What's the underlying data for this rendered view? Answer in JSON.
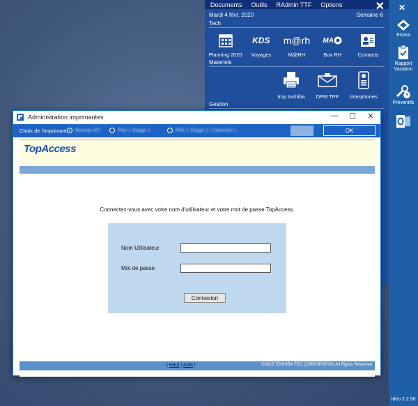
{
  "launcher": {
    "menu": [
      "Documents",
      "Outils",
      "RAdmin TTF",
      "Options"
    ],
    "close": "✕",
    "date": "Mardi 4 févr. 2020",
    "week": "Semaine 6",
    "sections": {
      "tech": "Tech",
      "materiels": "Materiels",
      "gestion": "Gestion"
    },
    "tech_tiles": [
      "Planning 2020",
      "Voyages",
      "M@RH",
      "Box RH",
      "Contacts"
    ],
    "tech_logos": {
      "kds": "KDS",
      "marh": "m@rh",
      "ma": "MA"
    },
    "materiel_tiles": [
      "Imp toshiba",
      "DPM TPF",
      "Interphones"
    ]
  },
  "sidebar": {
    "close": "✕",
    "items": [
      "Enova",
      "Rapport Vacation",
      "Préventifs"
    ],
    "version": "Ideo 2.2.56",
    "colors": {
      "bg": "#1f5fa8"
    }
  },
  "dialog": {
    "title": "Administration imprimantes",
    "min": "—",
    "max": "☐",
    "close": "✕",
    "printer_label": "Choix de l'imprimante :",
    "printers": [
      "Bureau RT",
      "Plot 1 Etage 1",
      "Plot 1 Etage 2 ( Direction )"
    ],
    "ok": "OK"
  },
  "topaccess": {
    "logo": "TopAccess",
    "message": "Connectez-vous avec votre nom d'utilisateur et votre mot de passe TopAccess.",
    "username_label": "Nom Utilisateur",
    "password_label": "Mot de passe",
    "username_value": "",
    "password_value": "",
    "connect": "Connexion",
    "footer_sep1": "|",
    "footer_link1": "Haut",
    "footer_sep2": "|",
    "footer_link2": "Aide",
    "footer_sep3": "|",
    "copyright": "©2015 TOSHIBA TEC CORPORATION All Rights Reserved"
  }
}
